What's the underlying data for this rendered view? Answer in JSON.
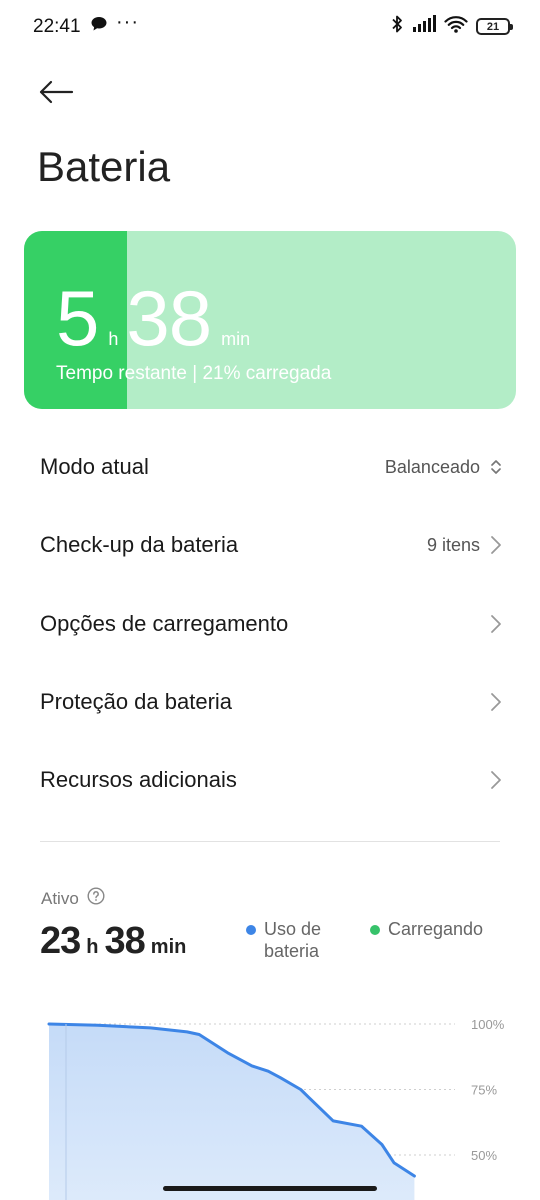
{
  "status": {
    "time": "22:41",
    "dots": "···",
    "battery": "21"
  },
  "page": {
    "title": "Bateria"
  },
  "battery_card": {
    "hours": "5",
    "hours_unit": "h",
    "minutes": "38",
    "minutes_unit": "min",
    "subtitle": "Tempo restante | 21% carregada",
    "level_percent": 21,
    "level_color": "#36d065",
    "bg_color": "#b3edc7"
  },
  "menu": {
    "mode_label": "Modo atual",
    "mode_value": "Balanceado",
    "checkup_label": "Check-up da bateria",
    "checkup_value": "9 itens",
    "charging_options_label": "Opções de carregamento",
    "protection_label": "Proteção da bateria",
    "extra_label": "Recursos adicionais"
  },
  "usage": {
    "active_label": "Ativo",
    "active_hours": "23",
    "active_hours_unit": "h",
    "active_minutes": "38",
    "active_minutes_unit": "min",
    "legend_usage": "Uso de bateria",
    "legend_usage_line1": "Uso de",
    "legend_usage_line2": "bateria",
    "legend_charging": "Carregando",
    "usage_color": "#3d85e6",
    "charging_color": "#36c26a"
  },
  "chart_data": {
    "type": "area",
    "y_ticks": [
      "100%",
      "75%",
      "50%"
    ],
    "ylim": [
      0,
      100
    ],
    "series": [
      {
        "name": "Uso de bateria",
        "x": [
          0,
          0.12,
          0.25,
          0.34,
          0.37,
          0.44,
          0.5,
          0.54,
          0.57,
          0.62,
          0.64,
          0.7,
          0.77,
          0.82,
          0.85,
          0.9
        ],
        "values": [
          100,
          99.5,
          98.5,
          97,
          96,
          89,
          84,
          82,
          79.5,
          75,
          72,
          63,
          61,
          54,
          47,
          42
        ]
      }
    ]
  }
}
